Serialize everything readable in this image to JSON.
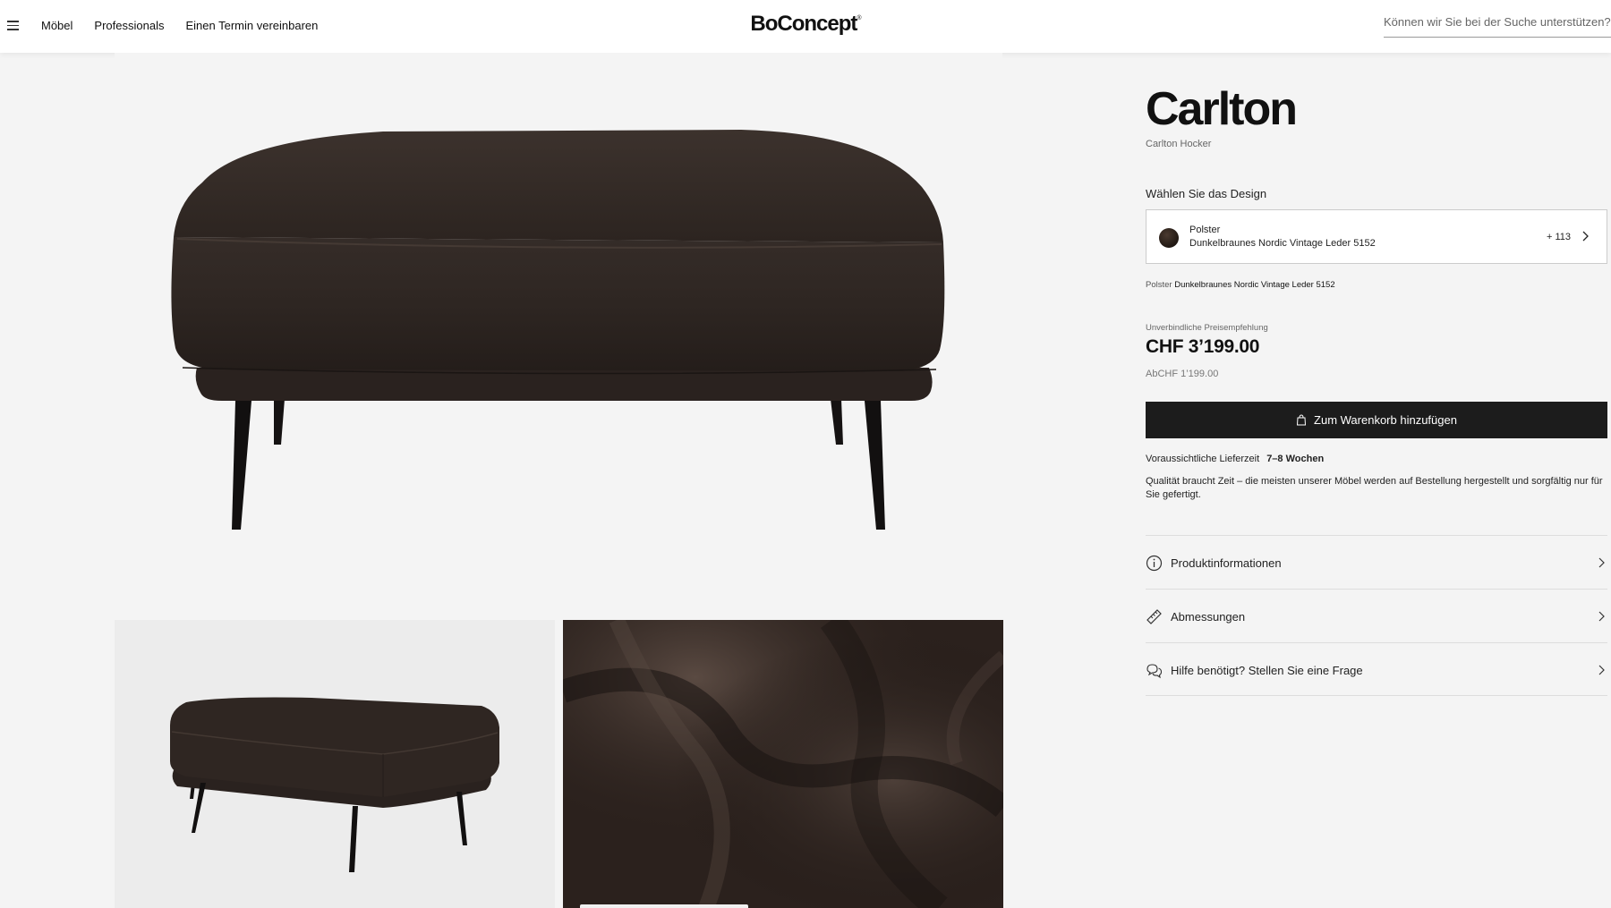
{
  "header": {
    "nav": [
      "Möbel",
      "Professionals",
      "Einen Termin vereinbaren"
    ],
    "logo": "BoConcept",
    "logo_mark": "®",
    "search_placeholder": "Können wir Sie bei der Suche unterstützen?"
  },
  "product": {
    "title": "Carlton",
    "subtitle": "Carlton Hocker",
    "design_label": "Wählen Sie das Design",
    "design": {
      "category": "Polster",
      "value": "Dunkelbraunes Nordic Vintage Leder 5152",
      "count": "+ 113",
      "swatch_color": "#2a1f19"
    },
    "summary_key": "Polster",
    "summary_value": "Dunkelbraunes Nordic Vintage Leder 5152",
    "rrp_label": "Unverbindliche Preisempfehlung",
    "price": "CHF 3’199.00",
    "price_from": "AbCHF 1’199.00",
    "cart_button": "Zum Warenkorb hinzufügen",
    "delivery_label": "Voraussichtliche Lieferzeit",
    "delivery_value": "7–8 Wochen",
    "quality_text": "Qualität braucht Zeit – die meisten unserer Möbel werden auf Bestellung hergestellt und sorgfältig nur für Sie gefertigt."
  },
  "accordion": [
    {
      "label": "Produktinformationen",
      "icon": "info-icon"
    },
    {
      "label": "Abmessungen",
      "icon": "ruler-icon"
    },
    {
      "label": "Hilfe benötigt? Stellen Sie eine Frage",
      "icon": "chat-icon"
    }
  ],
  "colors": {
    "leather": "#2e2521",
    "button_bg": "#1c1c1c",
    "page_bg": "#f4f4f4"
  }
}
